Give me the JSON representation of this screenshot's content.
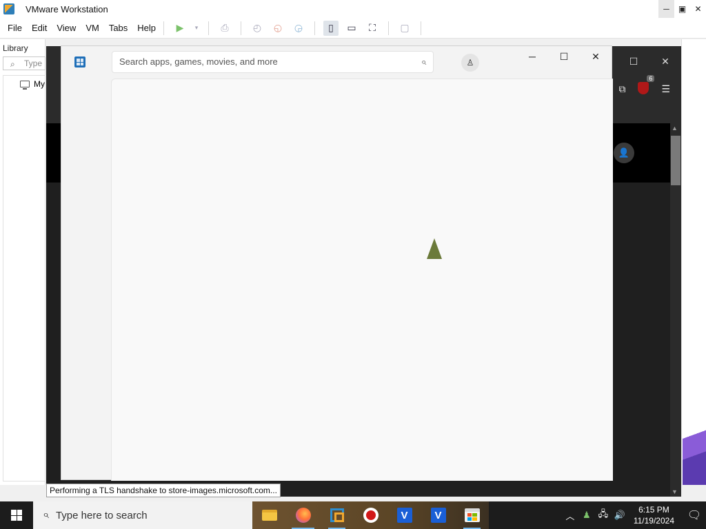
{
  "vmware": {
    "title": "VMware Workstation",
    "menu": [
      "File",
      "Edit",
      "View",
      "VM",
      "Tabs",
      "Help"
    ],
    "library_label": "Library",
    "library_search_placeholder": "Type",
    "library_node": "My"
  },
  "store": {
    "search_placeholder": "Search apps, games, movies, and more"
  },
  "firefox": {
    "extension_badge": "6"
  },
  "status_bar_text": "Performing a TLS handshake to store-images.microsoft.com...",
  "taskbar": {
    "search_placeholder": "Type here to search",
    "time": "6:15 PM",
    "date": "11/19/2024"
  },
  "colors": {
    "taskbar_bg": "#1c1c1c",
    "store_bg": "#f3f3f3",
    "accent": "#76b9ed"
  }
}
